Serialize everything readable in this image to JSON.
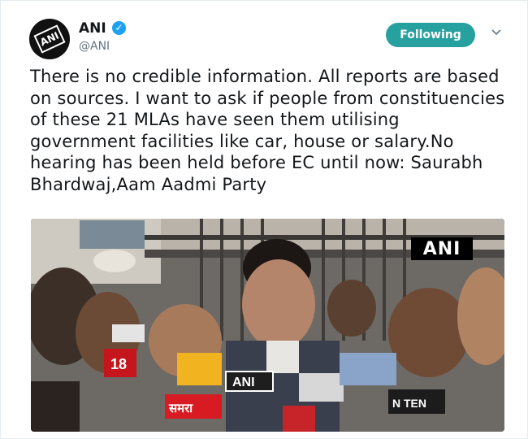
{
  "account": {
    "name": "ANI",
    "handle": "@ANI",
    "avatar_logo": "ANI"
  },
  "follow_button": {
    "label": "Following"
  },
  "tweet": {
    "text": "There is no credible information. All reports are based on sources. I want to ask if people from constituencies of these 21 MLAs have seen them utilising government facilities like car, house or salary.No hearing has been held before EC until now: Saurabh Bhardwaj,Aam Aadmi Party"
  },
  "media": {
    "watermark": "ANI",
    "mic_labels": [
      "ANI",
      "18",
      "समरा",
      "N TEN"
    ]
  },
  "icons": {
    "verified": "verified-badge-icon",
    "menu": "chevron-down-icon"
  },
  "colors": {
    "follow_bg": "#27a1a0",
    "verified": "#1da1f2",
    "handle": "#657786"
  }
}
